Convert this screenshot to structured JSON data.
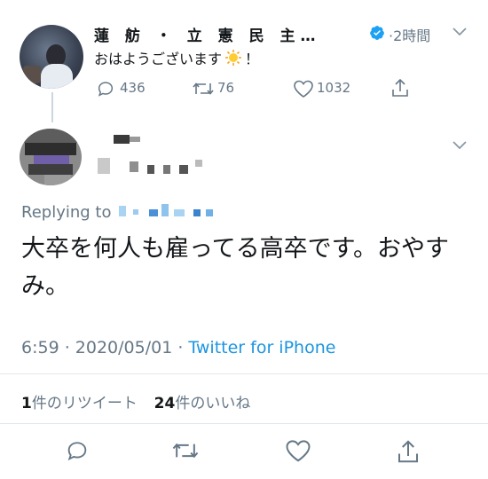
{
  "original_tweet": {
    "author_name": "蓮 舫 ・ 立 憲 民 主…",
    "time": "·2時間",
    "text_before_emoji": "おはようございます",
    "emoji": "sun-emoji",
    "text_after_emoji": "！",
    "reply_count": "436",
    "retweet_count": "76",
    "like_count": "1032"
  },
  "reply_tweet": {
    "replying_to_label": "Replying to",
    "text": "大卒を何人も雇ってる高卒です。おやすみ。",
    "timestamp": "6:59 · 2020/05/01 · ",
    "source": "Twitter for iPhone",
    "retweets_number": "1",
    "retweets_label": "件のリツイート",
    "likes_number": "24",
    "likes_label": "件のいいね"
  },
  "colors": {
    "text": "#14171a",
    "secondary": "#657786",
    "link": "#1b95e0",
    "divider": "#e1e8ed",
    "verified": "#1da1f2"
  }
}
